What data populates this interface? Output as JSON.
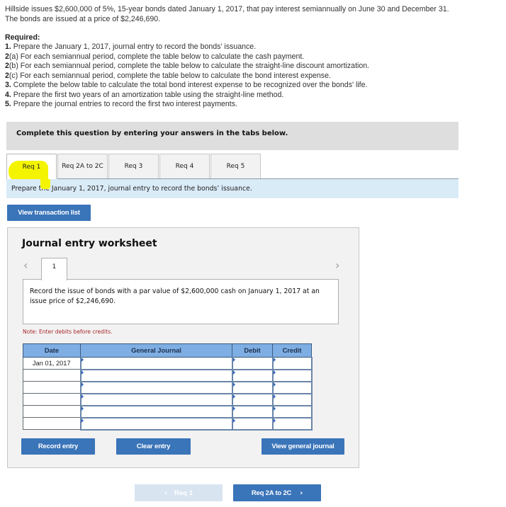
{
  "intro": {
    "line1": "Hillside issues $2,600,000 of 5%, 15-year bonds dated January 1, 2017, that pay interest semiannually on June 30 and December 31.",
    "line2": "The bonds are issued at a price of $2,246,690."
  },
  "required": {
    "heading": "Required:",
    "items": [
      {
        "num": "1.",
        "text": " Prepare the January 1, 2017, journal entry to record the bonds’ issuance."
      },
      {
        "num": "2",
        "text": "(a) For each semiannual period, complete the table below to calculate the cash payment."
      },
      {
        "num": "2",
        "text": "(b) For each semiannual period, complete the table below to calculate the straight-line discount amortization."
      },
      {
        "num": "2",
        "text": "(c) For each semiannual period, complete the table below to calculate the bond interest expense."
      },
      {
        "num": "3.",
        "text": " Complete the below table to calculate the total bond interest expense to be recognized over the bonds' life."
      },
      {
        "num": "4.",
        "text": " Prepare the first two years of an amortization table using the straight-line method."
      },
      {
        "num": "5.",
        "text": " Prepare the journal entries to record the first two interest payments."
      }
    ]
  },
  "banner": "Complete this question by entering your answers in the tabs below.",
  "tabs": [
    {
      "label": "Req 1",
      "active": true
    },
    {
      "label": "Req 2A to 2C",
      "active": false
    },
    {
      "label": "Req 3",
      "active": false
    },
    {
      "label": "Req 4",
      "active": false
    },
    {
      "label": "Req 5",
      "active": false
    }
  ],
  "prompt": "Prepare the January 1, 2017, journal entry to record the bonds’ issuance.",
  "buttons": {
    "view_transaction_list": "View transaction list",
    "record_entry": "Record entry",
    "clear_entry": "Clear entry",
    "view_general_journal": "View general journal"
  },
  "worksheet": {
    "title": "Journal entry worksheet",
    "prev_icon": "chevron-left-icon",
    "next_icon": "chevron-right-icon",
    "current_tab": "1",
    "description": "Record the issue of bonds with a par value of $2,600,000 cash on January 1, 2017 at an issue price of $2,246,690.",
    "note": "Note: Enter debits before credits.",
    "table": {
      "headers": [
        "Date",
        "General Journal",
        "Debit",
        "Credit"
      ],
      "rows": [
        {
          "date": "Jan 01, 2017",
          "account": "",
          "debit": "",
          "credit": ""
        },
        {
          "date": "",
          "account": "",
          "debit": "",
          "credit": ""
        },
        {
          "date": "",
          "account": "",
          "debit": "",
          "credit": ""
        },
        {
          "date": "",
          "account": "",
          "debit": "",
          "credit": ""
        },
        {
          "date": "",
          "account": "",
          "debit": "",
          "credit": ""
        },
        {
          "date": "",
          "account": "",
          "debit": "",
          "credit": ""
        }
      ]
    }
  },
  "nav": {
    "prev_label": "Req 1",
    "prev_icon": "‹",
    "next_label": "Req 2A to 2C",
    "next_icon": "›"
  },
  "colors": {
    "button_blue": "#3a74b9",
    "prompt_bg": "#daebf8",
    "table_header": "#7eaee3",
    "note_red": "#a8262b",
    "highlight_yellow": "#f4f400"
  }
}
